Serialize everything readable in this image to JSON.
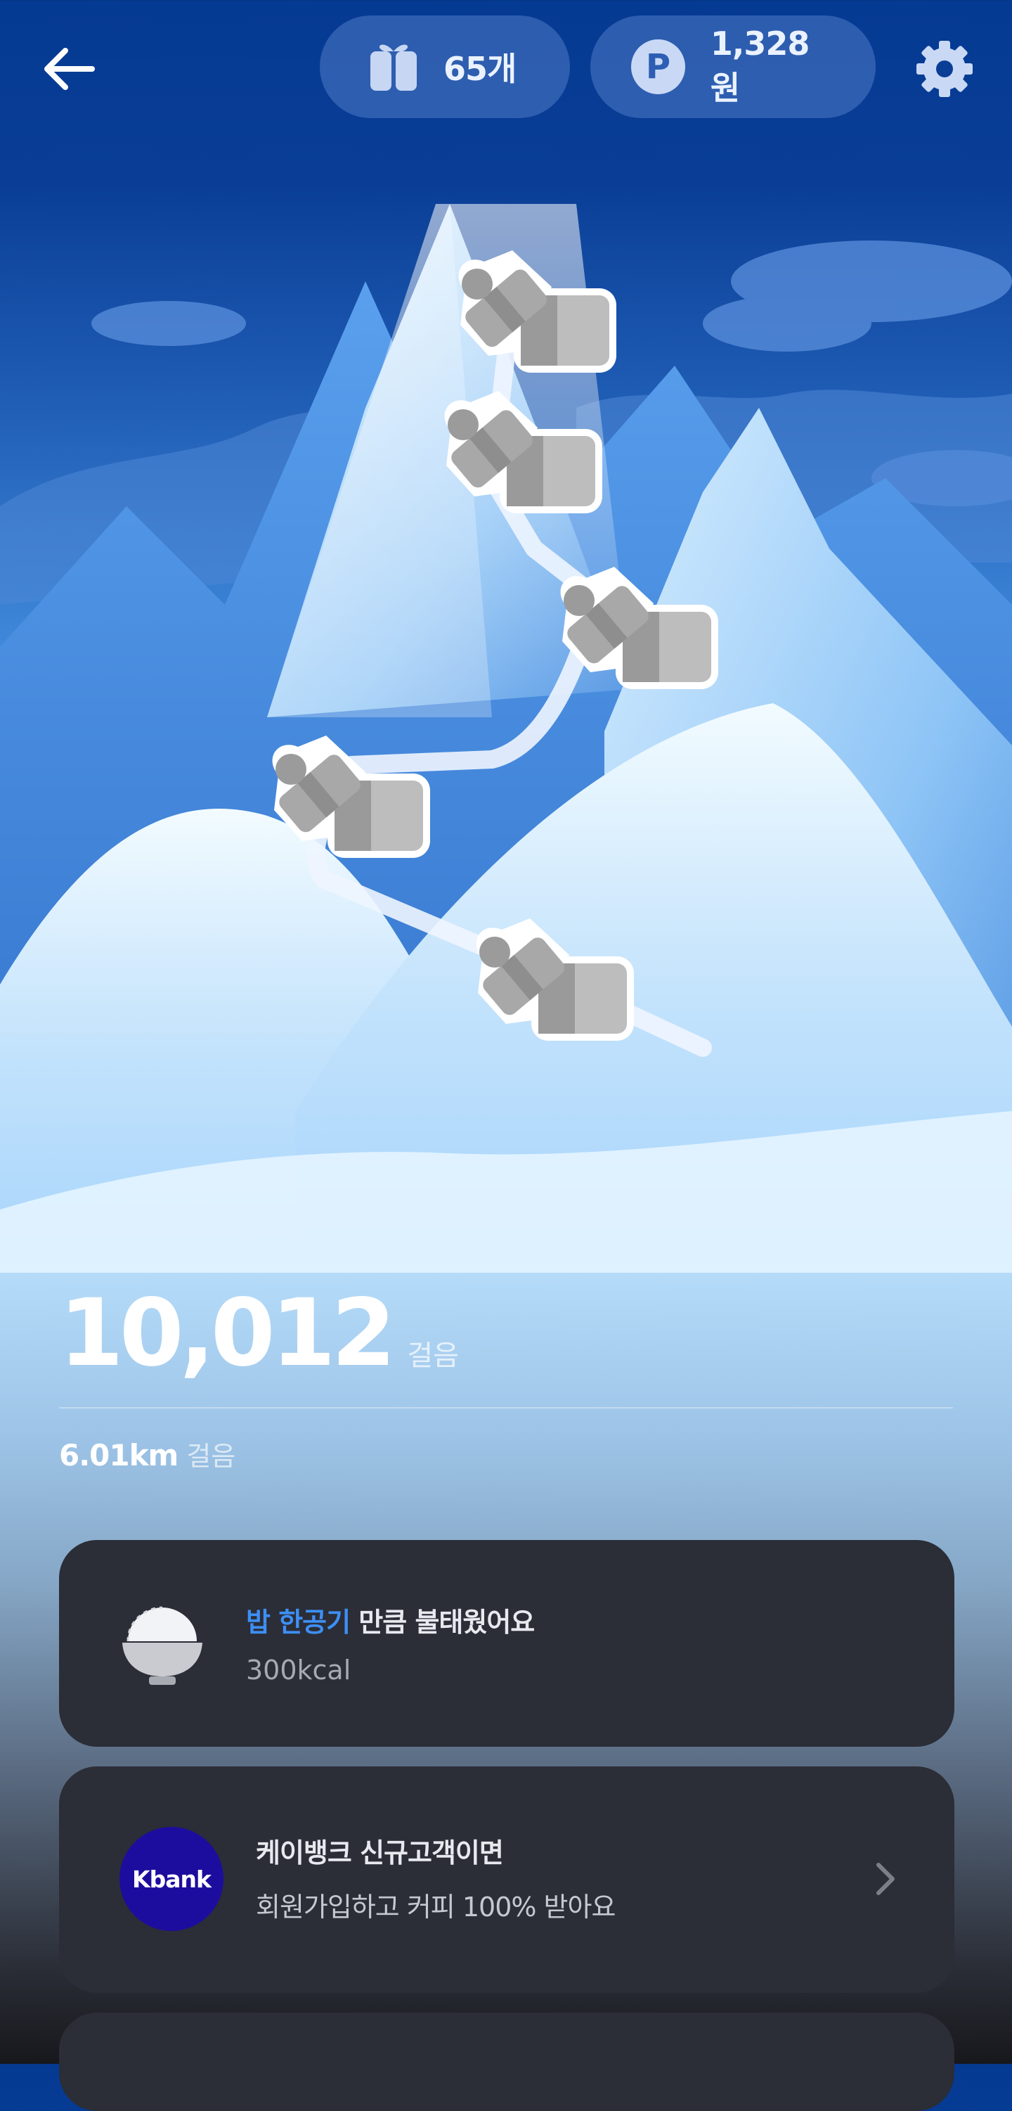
{
  "header": {
    "gift_count": "65개",
    "points": "1,328원",
    "point_badge": "P"
  },
  "stats": {
    "steps": "10,012",
    "steps_unit": "걸음",
    "distance": "6.01km",
    "distance_unit": "걸음"
  },
  "kcal_card": {
    "highlight": "밥 한공기",
    "title_rest": " 만큼 불태웠어요",
    "calories": "300kcal"
  },
  "kbank_card": {
    "logo": "Kbank",
    "title": "케이뱅크 신규고객이면",
    "subtitle": "회원가입하고 커피 100% 받아요"
  },
  "icons": [
    "back-arrow-icon",
    "gift-icon",
    "point-icon",
    "gear-icon",
    "rice-bowl-icon",
    "chevron-right-icon",
    "gift-box-icon"
  ],
  "colors": {
    "highlight": "#3d8ff5",
    "card": "#2b2d37",
    "kbank": "#1d0d9e"
  }
}
